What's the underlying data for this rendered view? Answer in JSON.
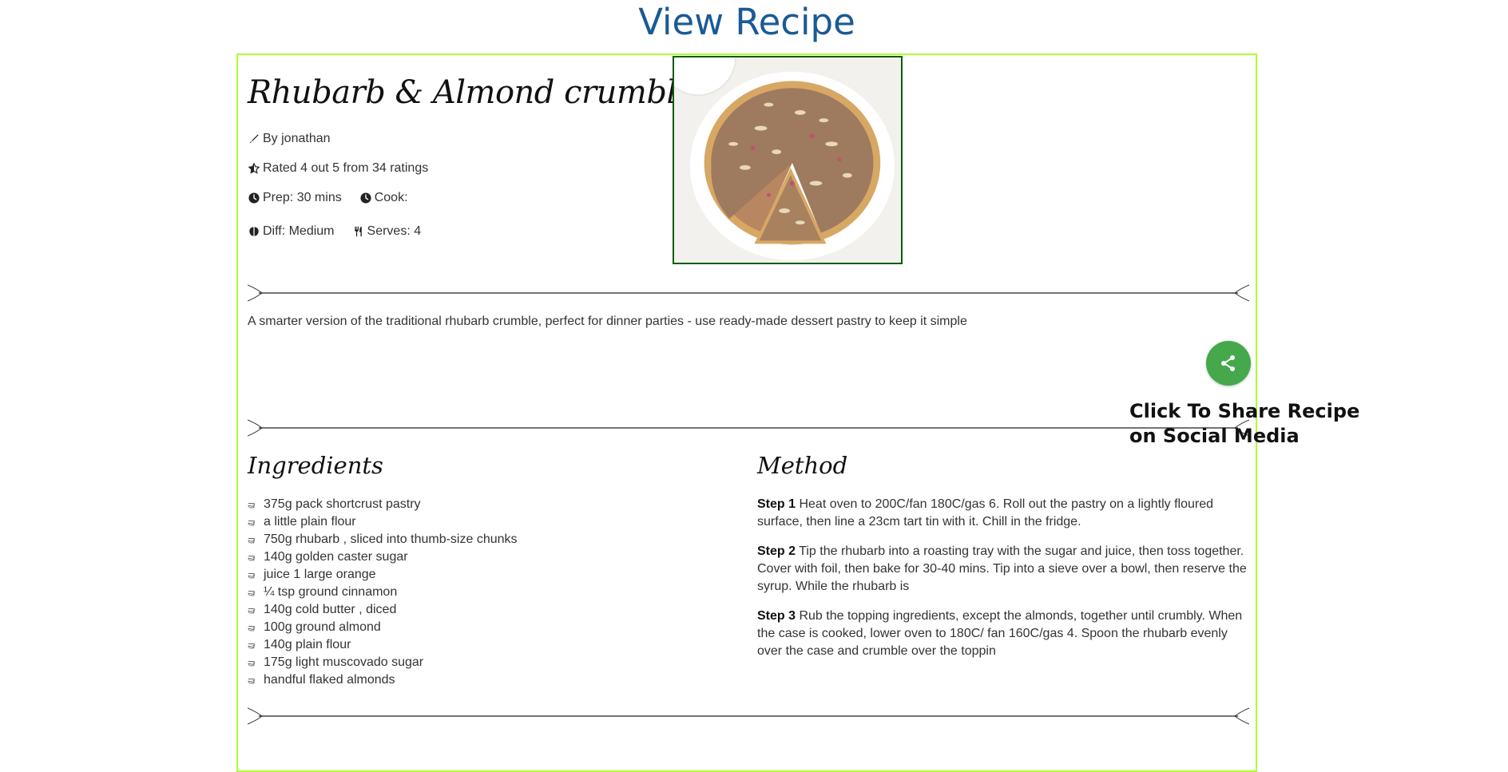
{
  "page": {
    "heading": "View Recipe"
  },
  "recipe": {
    "title": "Rhubarb & Almond crumble tart",
    "author": "By jonathan",
    "rating": "Rated 4 out 5 from 34 ratings",
    "prep": "Prep: 30 mins",
    "cook": "Cook:",
    "difficulty": "Diff: Medium",
    "serves": "Serves: 4",
    "description": "A smarter version of the traditional rhubarb crumble, perfect for dinner parties - use ready-made dessert pastry to keep it simple"
  },
  "share": {
    "caption": "Click To Share Recipe on Social Media"
  },
  "ingredients": {
    "heading": "Ingredients",
    "items": [
      "375g pack shortcrust pastry",
      "a little plain flour",
      "750g rhubarb , sliced into thumb-size chunks",
      "140g golden caster sugar",
      "juice 1 large orange",
      "¼ tsp ground cinnamon",
      "140g cold butter , diced",
      "100g ground almond",
      "140g plain flour",
      "175g light muscovado sugar",
      "handful flaked almonds"
    ]
  },
  "method": {
    "heading": "Method",
    "steps": [
      {
        "label": "Step 1",
        "text": "Heat oven to 200C/fan 180C/gas 6. Roll out the pastry on a lightly floured surface, then line a 23cm tart tin with it. Chill in the fridge."
      },
      {
        "label": "Step 2",
        "text": "Tip the rhubarb into a roasting tray with the sugar and juice, then toss together. Cover with foil, then bake for 30-40 mins. Tip into a sieve over a bowl, then reserve the syrup. While the rhubarb is"
      },
      {
        "label": "Step 3",
        "text": "Rub the topping ingredients, except the almonds, together until crumbly. When the case is cooked, lower oven to 180C/ fan 160C/gas 4. Spoon the rhubarb evenly over the case and crumble over the toppin"
      }
    ]
  },
  "colors": {
    "heading_blue": "#1a5a96",
    "card_border": "#adff2f",
    "image_border": "#0a5c0a",
    "share_green": "#45a84b"
  }
}
